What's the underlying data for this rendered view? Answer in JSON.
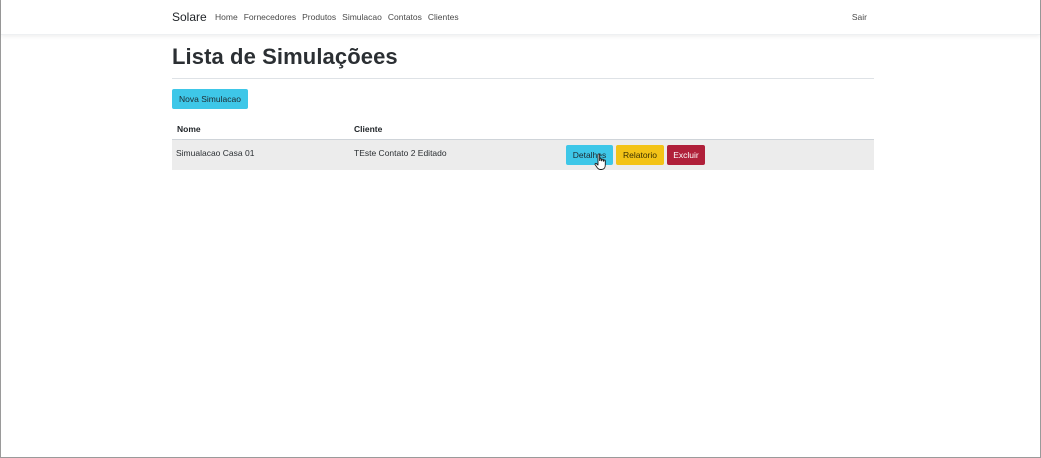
{
  "navbar": {
    "brand": "Solare",
    "links": [
      "Home",
      "Fornecedores",
      "Produtos",
      "Simulacao",
      "Contatos",
      "Clientes"
    ],
    "logout": "Sair"
  },
  "page": {
    "title": "Lista de Simulaçõees",
    "new_button": "Nova Simulacao"
  },
  "table": {
    "headers": {
      "nome": "Nome",
      "cliente": "Cliente"
    },
    "rows": [
      {
        "nome": "Simualacao Casa 01",
        "cliente": "TEste Contato 2 Editado",
        "actions": {
          "details": "Detalhes",
          "report": "Relatorio",
          "delete": "Excluir"
        }
      }
    ]
  },
  "colors": {
    "info": "#3ec7e8",
    "warning": "#f3c317",
    "danger": "#b0203a"
  },
  "icons": {
    "cursor": "hand-pointer-icon"
  }
}
